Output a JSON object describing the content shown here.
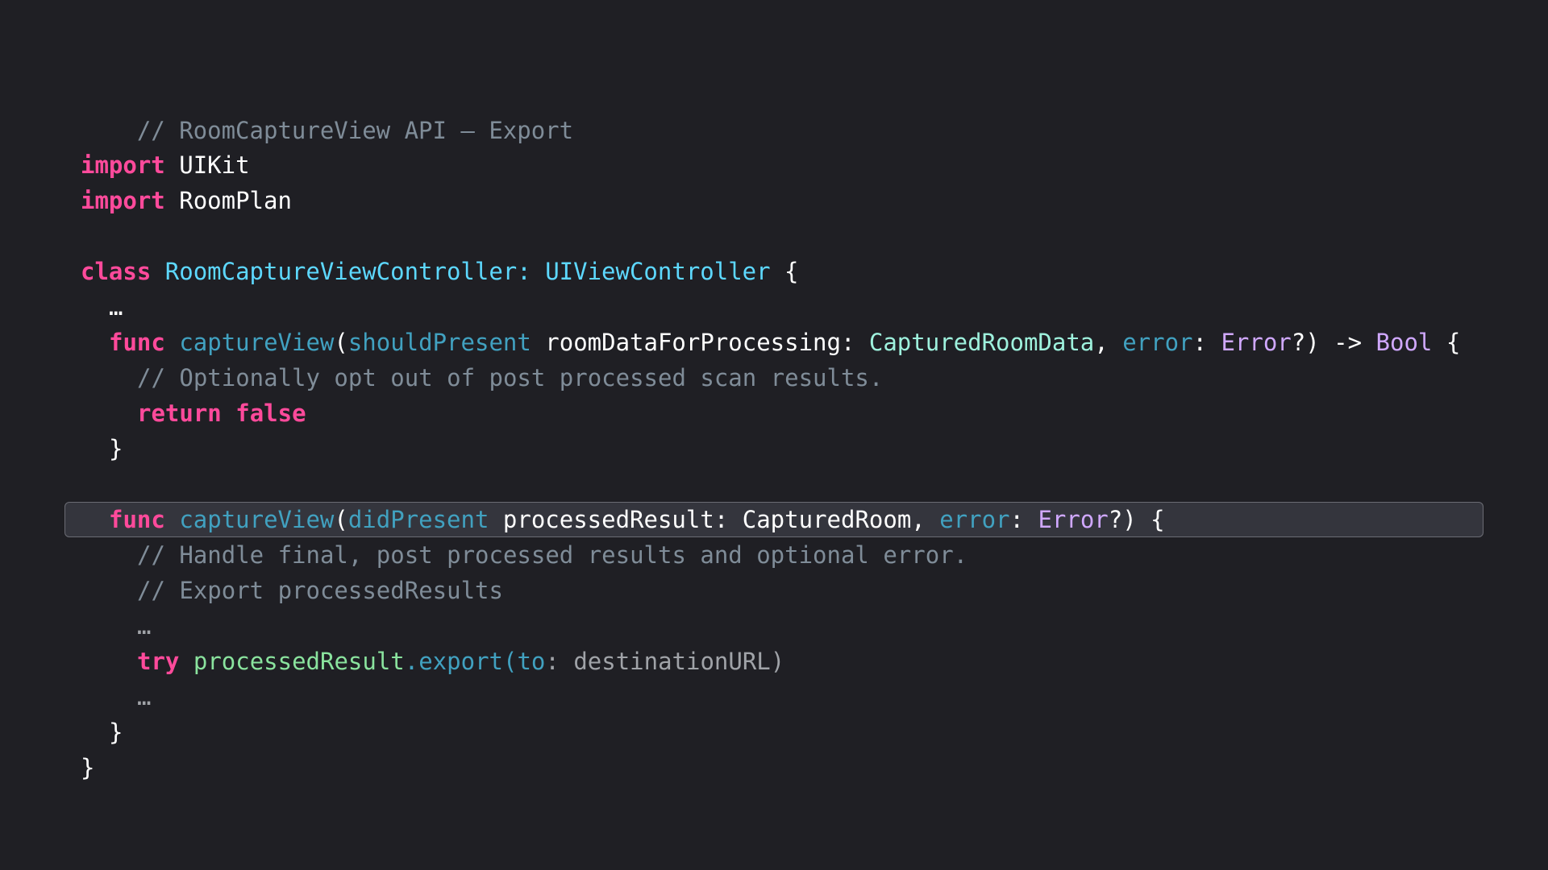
{
  "colors": {
    "background": "#1f1f24",
    "keyword": "#ff4a9b",
    "comment": "#7f8c98",
    "type_declaration": "#5dd8ff",
    "call": "#41a1c0",
    "type": "#d0a8ff",
    "highlight_fill": "#34353d",
    "highlight_border": "#6b6c74"
  },
  "code": {
    "header_comment": "// RoomCaptureView API – Export",
    "imports": [
      {
        "keyword": "import",
        "module": "UIKit"
      },
      {
        "keyword": "import",
        "module": "RoomPlan"
      }
    ],
    "class_decl": {
      "keyword": "class",
      "name": "RoomCaptureViewController",
      "colon": ":",
      "superclass": "UIViewController",
      "open_brace": "{"
    },
    "ellipsis_top": "…",
    "func1": {
      "keyword": "func",
      "name": "captureView",
      "open_paren": "(",
      "label": "shouldPresent",
      "param": "roomDataForProcessing",
      "colon": ":",
      "type": "CapturedRoomData",
      "comma": ",",
      "error_label": "error",
      "error_colon": ":",
      "error_type": "Error",
      "optional_close": "?)",
      "arrow": "->",
      "return_type": "Bool",
      "open_brace": "{",
      "comment": "// Optionally opt out of post processed scan results.",
      "return_keyword": "return",
      "return_value": "false",
      "close_brace": "}"
    },
    "func2": {
      "keyword": "func",
      "name": "captureView",
      "open_paren": "(",
      "label": "didPresent",
      "param": "processedResult",
      "colon": ":",
      "type": "CapturedRoom",
      "comma": ",",
      "error_label": "error",
      "error_colon": ":",
      "error_type": "Error",
      "optional_close": "?)",
      "open_brace": "{",
      "comment1": "// Handle final, post processed results and optional error.",
      "comment2": "// Export processedResults",
      "ellipsis1": "…",
      "try_keyword": "try",
      "receiver": "processedResult",
      "method": ".export(",
      "arg_label": "to",
      "arg_colon": ":",
      "arg_value": "destinationURL",
      "close_call": ")",
      "ellipsis2": "…",
      "close_brace": "}"
    },
    "class_close_brace": "}"
  }
}
